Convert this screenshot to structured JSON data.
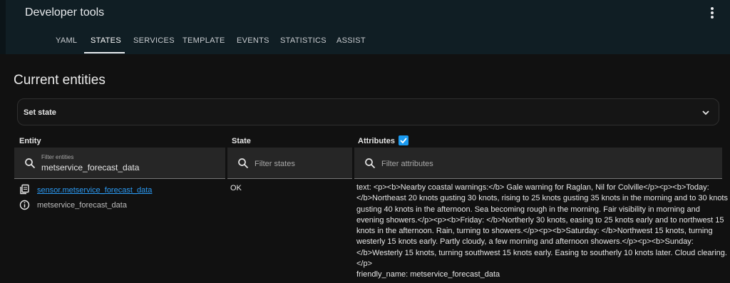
{
  "app": {
    "title": "Developer tools"
  },
  "tabs": [
    {
      "label": "YAML",
      "active": false
    },
    {
      "label": "STATES",
      "active": true
    },
    {
      "label": "SERVICES",
      "active": false
    },
    {
      "label": "TEMPLATE",
      "active": false
    },
    {
      "label": "EVENTS",
      "active": false
    },
    {
      "label": "STATISTICS",
      "active": false
    },
    {
      "label": "ASSIST",
      "active": false
    }
  ],
  "page": {
    "title": "Current entities"
  },
  "set_state": {
    "label": "Set state"
  },
  "columns": {
    "entity": "Entity",
    "state": "State",
    "attributes": "Attributes",
    "attributes_checked": true
  },
  "filters": {
    "entity": {
      "label": "Filter entities",
      "value": "metservice_forecast_data"
    },
    "state": {
      "placeholder": "Filter states"
    },
    "attributes": {
      "placeholder": "Filter attributes"
    }
  },
  "row": {
    "entity_id": "sensor.metservice_forecast_data",
    "friendly_name": "metservice_forecast_data",
    "state": "OK",
    "attributes_text": "text: <p><b>Nearby coastal warnings:</b> Gale warning for Raglan, Nil for Colville</p><p><b>Today: </b>Northeast 20 knots gusting 30 knots, rising to 25 knots gusting 35 knots in the morning and to 30 knots gusting 40 knots in the afternoon. Sea becoming rough in the morning. Fair visibility in morning and evening showers.</p><p><b>Friday: </b>Northerly 30 knots, easing to 25 knots early and to northwest 15 knots in the afternoon. Rain, turning to showers.</p><p><b>Saturday: </b>Northwest 15 knots, turning westerly 15 knots early. Partly cloudy, a few morning and afternoon showers.</p><p><b>Sunday: </b>Westerly 15 knots, turning southwest 15 knots early. Easing to southerly 10 knots later. Cloud clearing.</p>",
    "attributes_friendly": "friendly_name: metservice_forecast_data"
  },
  "icons": {
    "menu": "more-vertical-icon",
    "expand": "chevron-down-icon",
    "search": "magnify-icon",
    "copy": "clipboard-icon",
    "info": "info-circle-icon"
  },
  "colors": {
    "accent": "#1a9af0",
    "link": "#2b9af3",
    "header": "#101e24",
    "background": "#111111"
  }
}
